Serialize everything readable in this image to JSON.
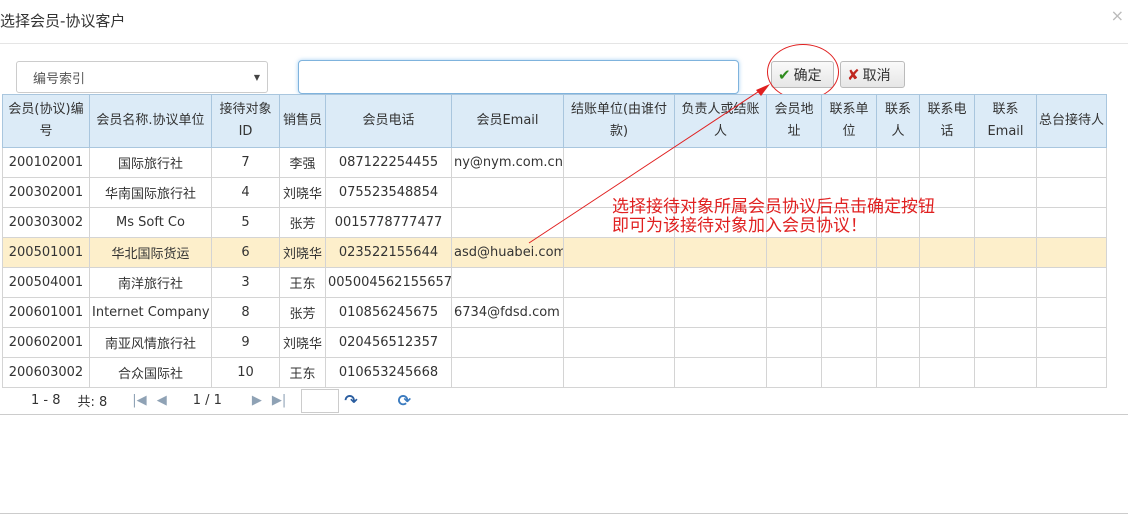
{
  "dialog": {
    "title": "选择会员-协议客户"
  },
  "toolbar": {
    "select_value": "编号索引",
    "search_value": "",
    "ok_label": "确定",
    "cancel_label": "取消"
  },
  "grid": {
    "headers": [
      "会员(协议)编号",
      "会员名称.协议单位",
      "接待对象ID",
      "销售员",
      "会员电话",
      "会员Email",
      "结账单位(由谁付款)",
      "负责人或结账人",
      "会员地址",
      "联系单位",
      "联系人",
      "联系电话",
      "联系Email",
      "总台接待人"
    ],
    "rows": [
      [
        "200102001",
        "国际旅行社",
        "7",
        "李强",
        "087122254455",
        "ny@nym.com.cn",
        "",
        "",
        "",
        "",
        "",
        "",
        "",
        ""
      ],
      [
        "200302001",
        "华南国际旅行社",
        "4",
        "刘晓华",
        "075523548854",
        "",
        "",
        "",
        "",
        "",
        "",
        "",
        "",
        ""
      ],
      [
        "200303002",
        "Ms Soft Co",
        "5",
        "张芳",
        "0015778777477",
        "",
        "",
        "",
        "",
        "",
        "",
        "",
        "",
        ""
      ],
      [
        "200501001",
        "华北国际货运",
        "6",
        "刘晓华",
        "023522155644",
        "asd@huabei.com",
        "",
        "",
        "",
        "",
        "",
        "",
        "",
        ""
      ],
      [
        "200504001",
        "南洋旅行社",
        "3",
        "王东",
        "005004562155657",
        "",
        "",
        "",
        "",
        "",
        "",
        "",
        "",
        ""
      ],
      [
        "200601001",
        "Internet Company",
        "8",
        "张芳",
        "010856245675",
        "6734@fdsd.com",
        "",
        "",
        "",
        "",
        "",
        "",
        "",
        ""
      ],
      [
        "200602001",
        "南亚风情旅行社",
        "9",
        "刘晓华",
        "020456512357",
        "",
        "",
        "",
        "",
        "",
        "",
        "",
        "",
        ""
      ],
      [
        "200603002",
        "合众国际社",
        "10",
        "王东",
        "010653245668",
        "",
        "",
        "",
        "",
        "",
        "",
        "",
        "",
        ""
      ]
    ],
    "selected_row": 3
  },
  "pager": {
    "range": "1 - 8",
    "total": "共: 8",
    "page": "1 / 1"
  },
  "annotation": {
    "line1": "选择接待对象所属会员协议后点击确定按钮",
    "line2": "即可为该接待对象加入会员协议！"
  },
  "colors": {
    "header_bg": "#dcebf7",
    "selected_row_bg": "#fdefcb",
    "annotation": "#e02020"
  }
}
